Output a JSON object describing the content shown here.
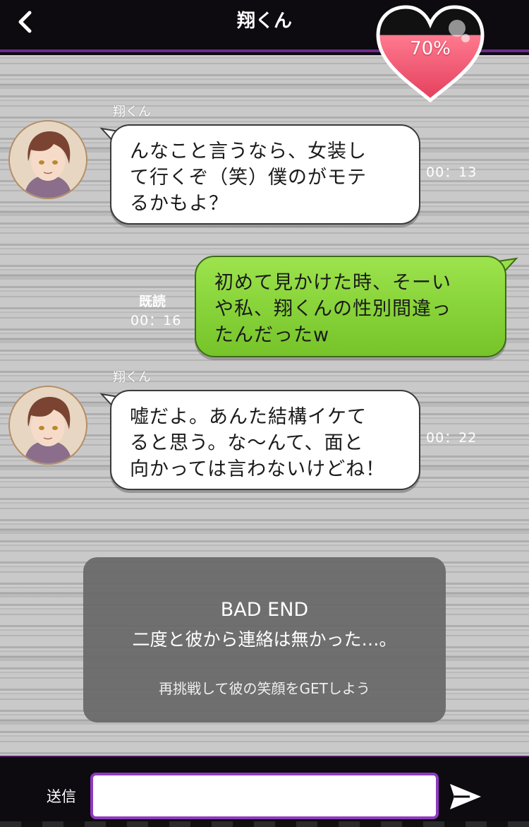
{
  "header": {
    "back_icon": "<",
    "title": "翔くん"
  },
  "affection_meter": {
    "label": "70%",
    "value_percent": 70,
    "icon": "heart-icon",
    "fill_color": "#f0536c"
  },
  "messages": [
    {
      "side": "left",
      "sender": "翔くん",
      "lines": [
        "んなこと言うなら、女装し",
        "て行くぞ（笑）僕のがモテ",
        "るかもよ？"
      ],
      "time": "00：13"
    },
    {
      "side": "right",
      "read_label": "既読",
      "lines": [
        "初めて見かけた時、そーい",
        "や私、翔くんの性別間違っ",
        "たんだったw"
      ],
      "time": "00：16"
    },
    {
      "side": "left",
      "sender": "翔くん",
      "lines": [
        "嘘だよ。あんた結構イケて",
        "ると思う。な〜んて、面と",
        "向かっては言わないけどね！"
      ],
      "time": "00：22"
    }
  ],
  "bad_end": {
    "title": "BAD END",
    "message": "二度と彼から連絡は無かった…。",
    "hint": "再挑戦して彼の笑顔をGETしよう"
  },
  "footer": {
    "send_label": "送信",
    "input_value": "",
    "input_placeholder": "",
    "send_icon": "paper-plane-icon"
  },
  "colors": {
    "accent_purple": "#8e3bbf",
    "bubble_green": "#86d238",
    "bubble_white": "#ffffff"
  }
}
